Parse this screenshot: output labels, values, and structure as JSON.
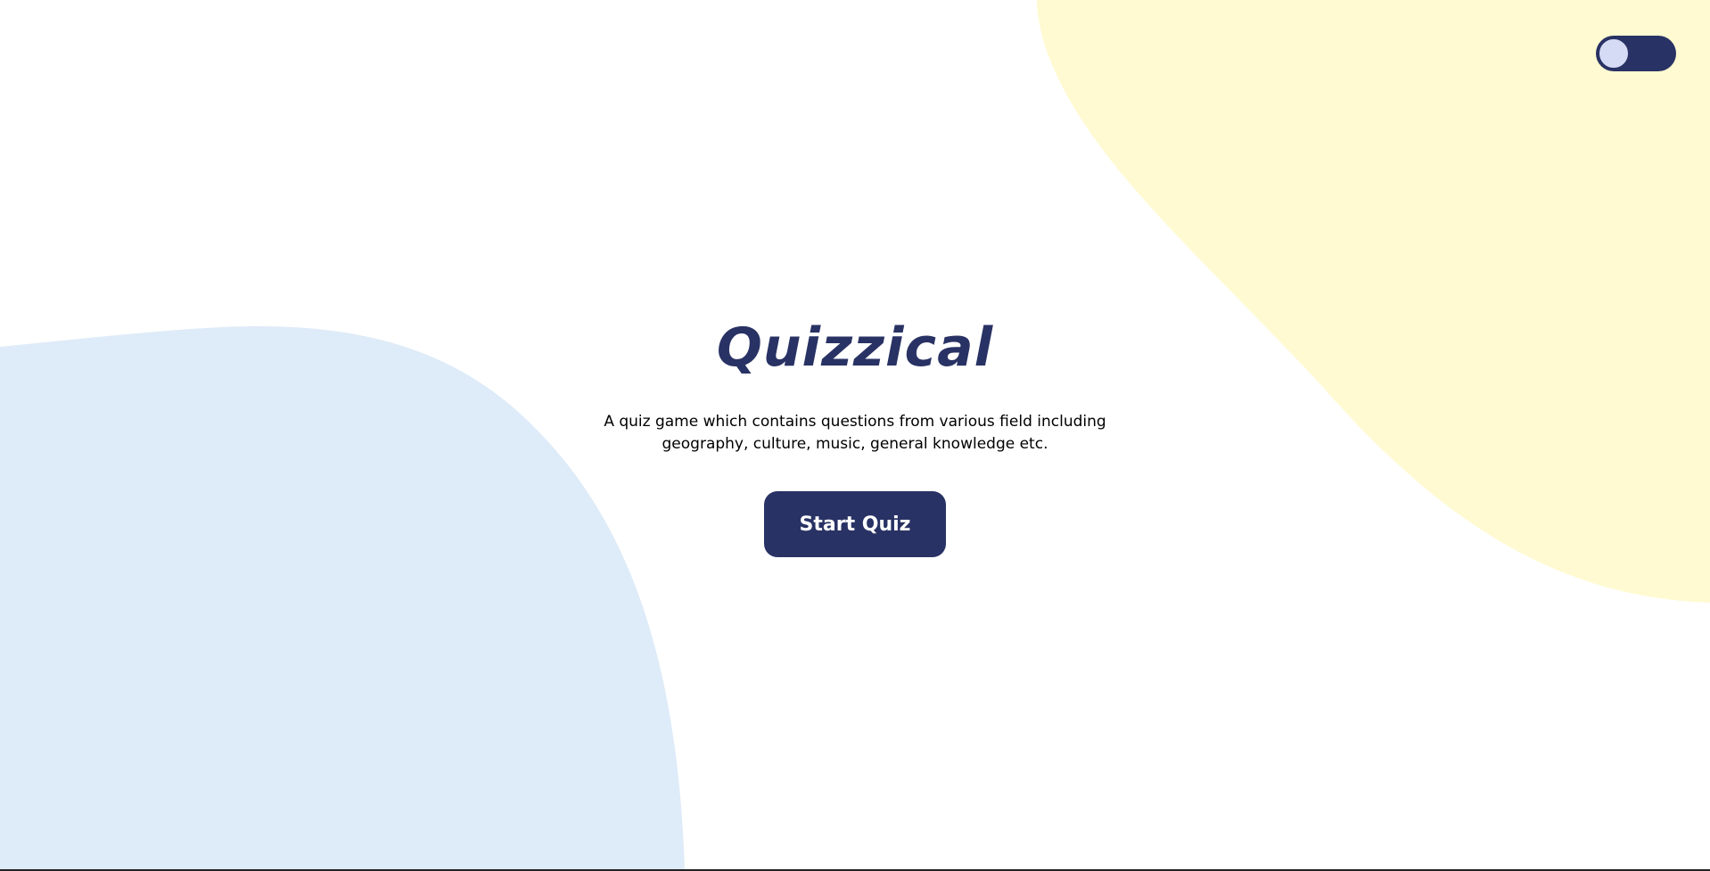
{
  "app": {
    "title": "Quizzical",
    "description": "A quiz game which contains questions from various field including geography, culture, music, general knowledge etc.",
    "start_button_label": "Start Quiz"
  },
  "theme_toggle": {
    "state": "off",
    "icon": "toggle-switch-icon"
  },
  "colors": {
    "primary": "#293264",
    "blob_yellow": "#FFFAD1",
    "blob_blue": "#DEEBF8",
    "toggle_knob": "#D6DBF5",
    "background": "#FFFFFF"
  }
}
